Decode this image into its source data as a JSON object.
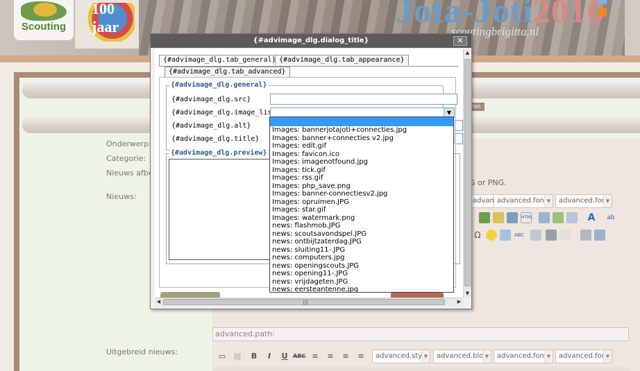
{
  "header": {
    "logo_text": "Scouting",
    "badge_text": "100 jaar",
    "event_title": "Jota-Joti",
    "event_year": "2010",
    "event_subtitle": "scoutingbrigitta.nl"
  },
  "form": {
    "labels": {
      "onderwerp": "Onderwerp:",
      "categorie": "Categorie:",
      "afbeelding": "Nieuws afbe",
      "nieuws": "Nieuws:",
      "uitgebreid": "Uitgebreid nieuws:"
    },
    "hint": "G or PNG.",
    "behind_button": "eren",
    "path_bar": "advanced.path:",
    "toolbar_selects": [
      "advanced.bloc",
      "advanced.font",
      "advanced.font"
    ],
    "toolbar2_selects": [
      "advanced.style",
      "advanced.bloc",
      "advanced.font",
      "advanced.font"
    ]
  },
  "dialog": {
    "title": "{#advimage_dlg.dialog_title}",
    "close_label": "✕",
    "tabs": {
      "general": "{#advimage_dlg.tab_general}",
      "appearance": "{#advimage_dlg.tab_appearance}",
      "advanced": "{#advimage_dlg.tab_advanced}"
    },
    "general_legend": "{#advimage_dlg.general}",
    "fields": {
      "src": "{#advimage_dlg.src}",
      "image_list": "{#advimage_dlg.image_list}",
      "alt": "{#advimage_dlg.alt}",
      "title": "{#advimage_dlg.title}"
    },
    "preview_legend": "{#advimage_dlg.preview}",
    "image_options": [
      "",
      "Images: bannerjotajoti+connecties.jpg",
      "Images: banner+connecties v2.jpg",
      "Images: edit.gif",
      "Images: favicon.ico",
      "Images: imagenotfound.jpg",
      "Images: tick.gif",
      "Images: rss.gif",
      "Images: php_save.png",
      "Images: banner-connectiesv2.jpg",
      "Images: opruimen.JPG",
      "Images: star.gif",
      "Images: watermark.png",
      "news: flashmob.JPG",
      "news: scoutsavondspel.JPG",
      "news: ontbijtzaterdag.JPG",
      "news: sluiting11-.JPG",
      "news: computers.jpg",
      "news: openingscouts.JPG",
      "news: opening11-.JPG",
      "news: vrijdageten.JPG",
      "news: eersteantenne.jpg"
    ]
  }
}
